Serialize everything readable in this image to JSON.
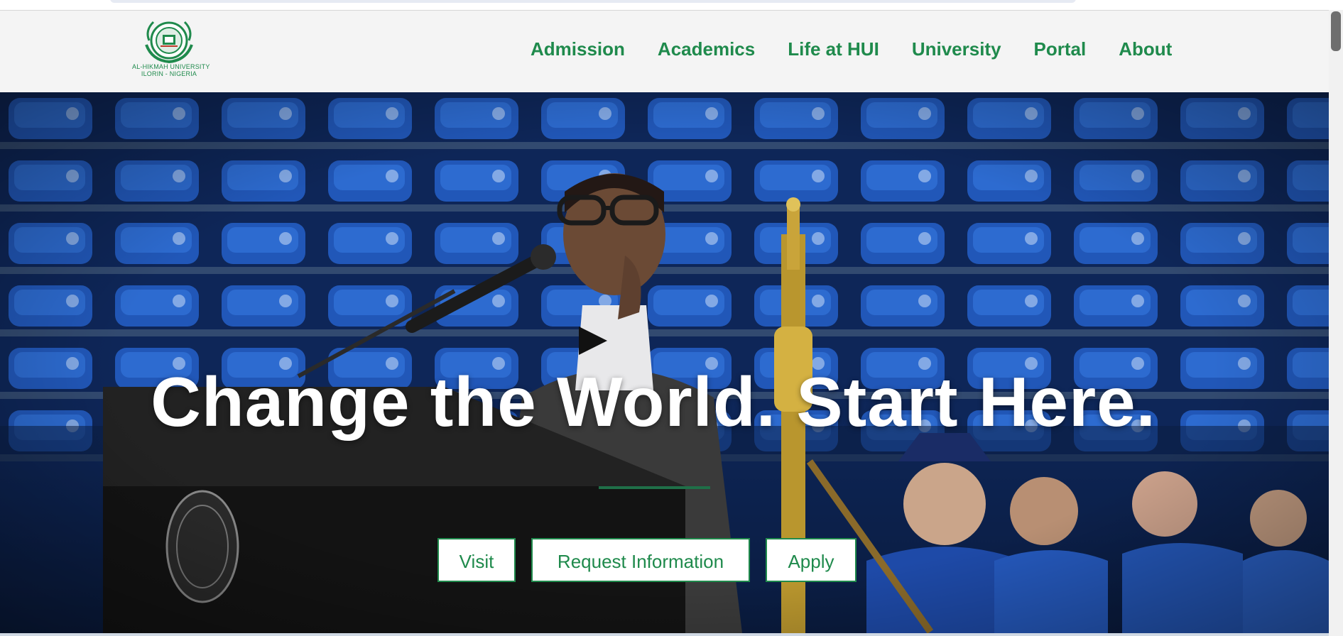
{
  "site": {
    "logo": {
      "line1": "AL-HIKMAH UNIVERSITY",
      "line2": "ILORIN - NIGERIA",
      "icon": "university-crest-icon"
    },
    "nav": [
      "Admission",
      "Academics",
      "Life at HUI",
      "University",
      "Portal",
      "About"
    ]
  },
  "hero": {
    "headline": "Change the World. Start Here.",
    "buttons": {
      "visit": "Visit",
      "request": "Request Information",
      "apply": "Apply"
    },
    "image": "graduation-speaker-photo"
  },
  "colors": {
    "brand_green": "#1f8a4c",
    "header_bg": "#f4f4f4",
    "seat_blue": "#1b4fb0"
  }
}
